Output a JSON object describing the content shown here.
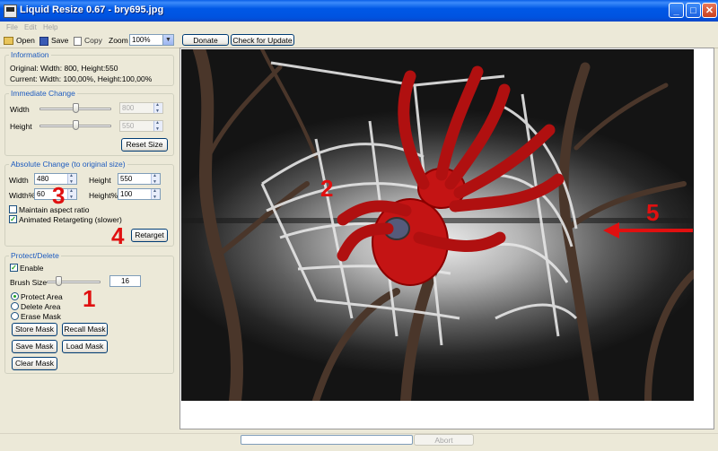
{
  "window": {
    "title": "Liquid Resize 0.67 - bry695.jpg"
  },
  "menu": [
    "File",
    "Edit",
    "Help"
  ],
  "toolbar": {
    "open": "Open",
    "save": "Save",
    "copy": "Copy",
    "zoom_label": "Zoom",
    "zoom_value": "100%",
    "donate": "Donate",
    "check_update": "Check for Update"
  },
  "information": {
    "title": "Information",
    "original": "Original: Width: 800, Height:550",
    "current": "Current: Width: 100,00%, Height:100,00%"
  },
  "immediate": {
    "title": "Immediate Change",
    "width_label": "Width",
    "width_value": "800",
    "height_label": "Height",
    "height_value": "550",
    "reset": "Reset Size"
  },
  "absolute": {
    "title": "Absolute Change (to original size)",
    "width_label": "Width",
    "width_value": "480",
    "height_label": "Height",
    "height_value": "550",
    "widthpct_label": "Width%",
    "widthpct_value": "60",
    "heightpct_label": "Height%",
    "heightpct_value": "100",
    "maintain": "Maintain aspect ratio",
    "animated": "Animated Retargeting (slower)",
    "retarget": "Retarget"
  },
  "protect": {
    "title": "Protect/Delete",
    "enable": "Enable",
    "brush_label": "Brush Size",
    "brush_value": "16",
    "protect_area": "Protect Area",
    "delete_area": "Delete Area",
    "erase_mask": "Erase Mask",
    "store_mask": "Store Mask",
    "recall_mask": "Recall Mask",
    "save_mask": "Save Mask",
    "load_mask": "Load Mask",
    "clear_mask": "Clear Mask"
  },
  "annotations": {
    "n1": "1",
    "n2": "2",
    "n3": "3",
    "n4": "4",
    "n5": "5"
  },
  "status": {
    "abort": "Abort"
  }
}
